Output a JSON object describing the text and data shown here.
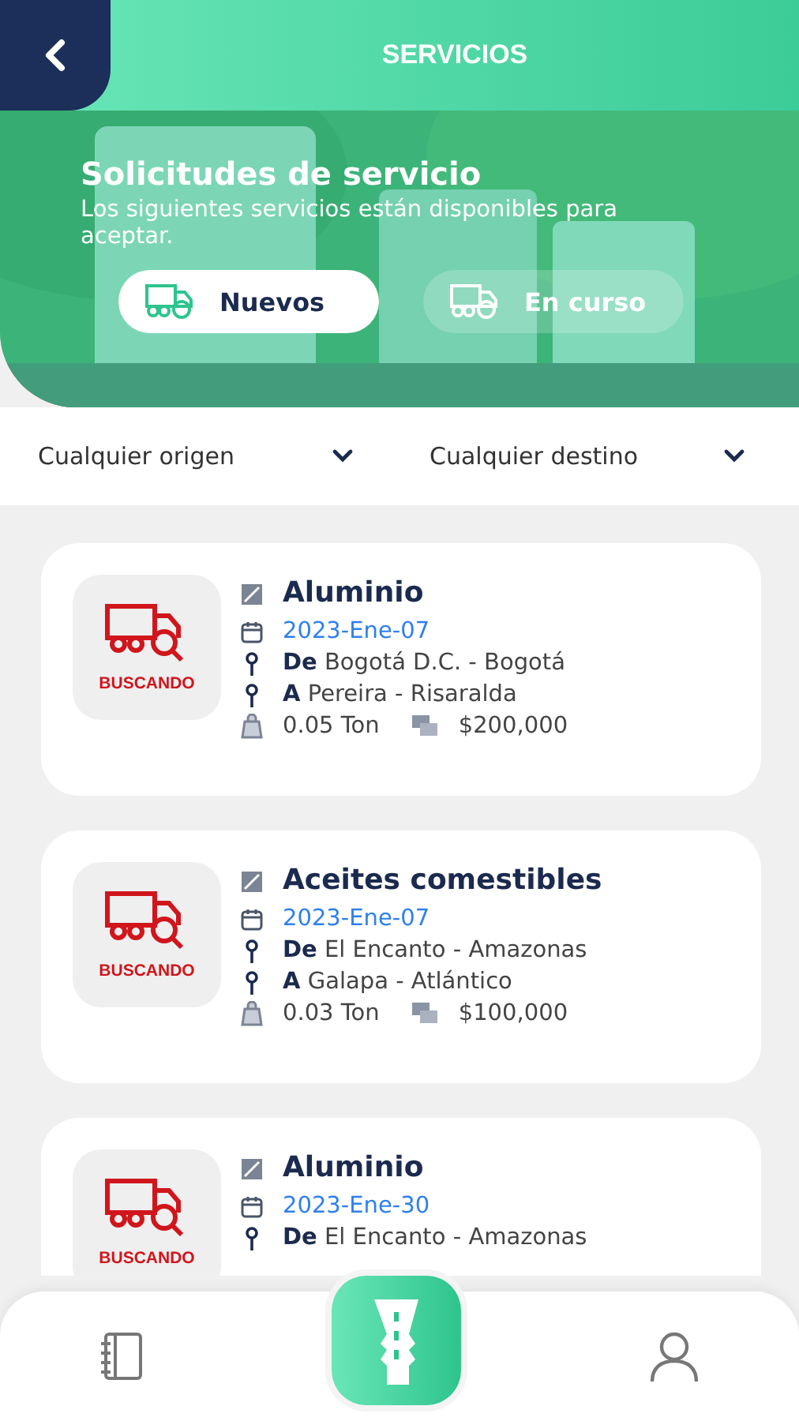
{
  "header": {
    "title": "SERVICIOS"
  },
  "hero": {
    "kind": "picture",
    "heading": "Solicitudes de servicio",
    "description": "Los siguientes servicios están disponibles para aceptar."
  },
  "tabs": [
    {
      "label": "Nuevos",
      "selected": true
    },
    {
      "label": "En curso",
      "selected": false
    }
  ],
  "filters": [
    {
      "value": "Cualquier origen"
    },
    {
      "value": "Cualquier destino"
    }
  ],
  "services": [
    {
      "status": "BUSCANDO",
      "product": "Aluminio",
      "date": "2023-Ene-07",
      "origin_prefix": "De",
      "origin": "Bogotá D.C. - Bogotá",
      "dest_prefix": "A",
      "destination": "Pereira - Risaralda",
      "weight": "0.05 Ton",
      "price": "$200,000"
    },
    {
      "status": "BUSCANDO",
      "product": "Aceites comestibles",
      "date": "2023-Ene-07",
      "origin_prefix": "De",
      "origin": "El Encanto - Amazonas",
      "dest_prefix": "A",
      "destination": "Galapa - Atlántico",
      "weight": "0.03 Ton",
      "price": "$100,000"
    },
    {
      "status": "BUSCANDO",
      "product": "Aluminio",
      "date": "2023-Ene-30",
      "origin_prefix": "De",
      "origin": "El Encanto - Amazonas"
    }
  ]
}
